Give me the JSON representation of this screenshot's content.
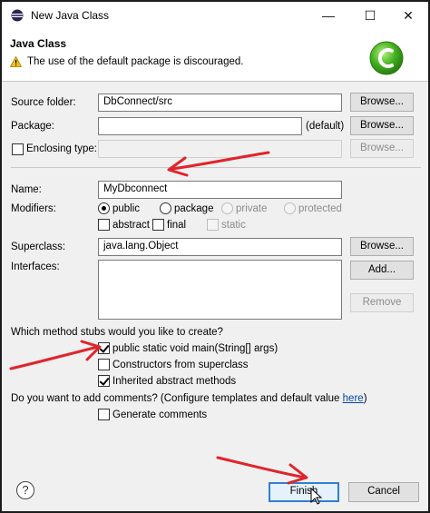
{
  "window": {
    "title": "New Java Class",
    "min_glyph": "—",
    "max_glyph": "☐",
    "close_glyph": "✕"
  },
  "header": {
    "title": "Java Class",
    "message": "The use of the default package is discouraged."
  },
  "form": {
    "source_folder": {
      "label": "Source folder:",
      "value": "DbConnect/src",
      "button": "Browse..."
    },
    "package": {
      "label": "Package:",
      "value": "",
      "suffix": "(default)",
      "button": "Browse..."
    },
    "enclosing_type": {
      "label": "Enclosing type:",
      "value": "",
      "button": "Browse..."
    },
    "name": {
      "label": "Name:",
      "value": "MyDbconnect"
    },
    "modifiers": {
      "label": "Modifiers:",
      "public": "public",
      "package": "package",
      "private": "private",
      "protected": "protected",
      "abstract": "abstract",
      "final": "final",
      "static": "static"
    },
    "superclass": {
      "label": "Superclass:",
      "value": "java.lang.Object",
      "button": "Browse..."
    },
    "interfaces": {
      "label": "Interfaces:",
      "add_button": "Add...",
      "remove_button": "Remove"
    },
    "stubs": {
      "question": "Which method stubs would you like to create?",
      "main": "public static void main(String[] args)",
      "constructors": "Constructors from superclass",
      "inherited": "Inherited abstract methods"
    },
    "comments": {
      "question_prefix": "Do you want to add comments? (Configure templates and default value ",
      "link": "here",
      "question_suffix": ")",
      "generate": "Generate comments"
    }
  },
  "footer": {
    "help_glyph": "?",
    "finish": "Finish",
    "cancel": "Cancel"
  },
  "colors": {
    "annotation_arrow": "#e0242b",
    "accent": "#2f7fd6"
  }
}
